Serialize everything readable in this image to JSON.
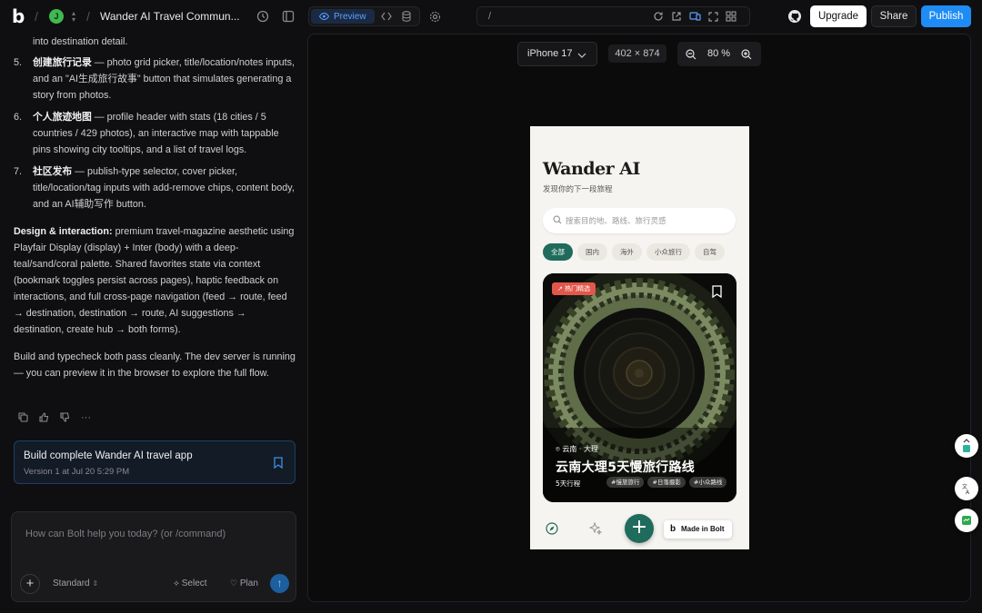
{
  "topbar": {
    "avatar_initial": "J",
    "project_title": "Wander AI Travel Commun...",
    "preview_label": "Preview",
    "url_path": "/",
    "upgrade_label": "Upgrade",
    "share_label": "Share",
    "publish_label": "Publish"
  },
  "chat": {
    "intro_line": "into destination detail.",
    "list_items": [
      {
        "num": "5.",
        "title": "创建旅行记录",
        "text": " — photo grid picker, title/location/notes inputs, and an \"AI生成旅行故事\" button that simulates generating a story from photos."
      },
      {
        "num": "6.",
        "title": "个人旅迹地图",
        "text": " — profile header with stats (18 cities / 5 countries / 429 photos), an interactive map with tappable pins showing city tooltips, and a list of travel logs."
      },
      {
        "num": "7.",
        "title": "社区发布",
        "text": " — publish-type selector, cover picker, title/location/tag inputs with add-remove chips, content body, and an AI辅助写作 button."
      }
    ],
    "design_heading": "Design & interaction:",
    "design_text": " premium travel-magazine aesthetic using Playfair Display (display) + Inter (body) with a deep-teal/sand/coral palette. Shared favorites state via context (bookmark toggles persist across pages), haptic feedback on interactions, and full cross-page navigation (feed → route, feed → destination, destination → route, AI suggestions → destination, create hub → both forms).",
    "build_text": "Build and typecheck both pass cleanly. The dev server is running — you can preview it in the browser to explore the full flow.",
    "version_title": "Build complete Wander AI travel app",
    "version_sub": "Version 1 at Jul 20 5:29 PM",
    "composer_placeholder": "How can Bolt help you today? (or /command)",
    "model_label": "Standard",
    "select_label": "Select",
    "plan_label": "Plan"
  },
  "preview": {
    "device": "iPhone 17",
    "dimensions": "402 × 874",
    "zoom": "80 %"
  },
  "phone": {
    "app_title": "Wander AI",
    "app_subtitle": "发现你的下一段旅程",
    "search_placeholder": "搜索目的地、路线、旅行灵感",
    "chips": [
      "全部",
      "国内",
      "海外",
      "小众旅行",
      "自驾"
    ],
    "card": {
      "badge": "热门精选",
      "location": "云南 · 大理",
      "title": "云南大理5天慢旅行路线",
      "days": "5天行程",
      "tags": [
        "#慢旅旅行",
        "#日落摄影",
        "#小众路线"
      ]
    },
    "made_in_bolt": "Made in Bolt"
  },
  "colors": {
    "accent_blue": "#1f8cf5",
    "teal": "#1f6b5c",
    "coral": "#e2574a"
  }
}
